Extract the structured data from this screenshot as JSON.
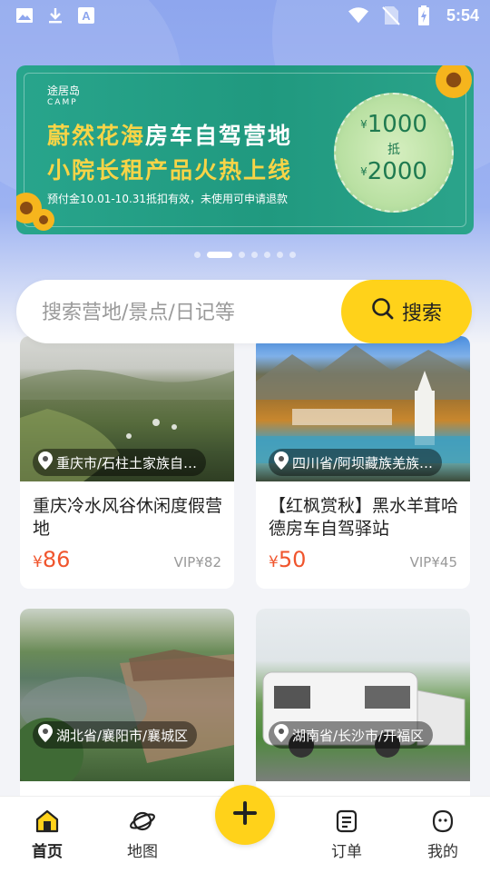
{
  "status_bar": {
    "time": "5:54",
    "left_icons": [
      "image-icon",
      "download-icon",
      "text-a-icon"
    ],
    "right_icons": [
      "wifi-icon",
      "no-sim-icon",
      "battery-charging-icon"
    ]
  },
  "banner": {
    "brand": "途居岛",
    "brand_en": "CAMP",
    "title_line1_highlight": "蔚然花海",
    "title_line1_rest": "房车自驾营地",
    "title_line2": "小院长租产品火热上线",
    "subtitle": "预付金10.01-10.31抵扣有效，未使用可申请退款",
    "coupon_amount1": "1000",
    "coupon_mid": "抵",
    "coupon_amount2": "2000",
    "currency": "¥"
  },
  "carousel": {
    "count": 7,
    "active_index": 1
  },
  "search": {
    "placeholder": "搜索营地/景点/日记等",
    "button_label": "搜索"
  },
  "cards": [
    {
      "location": "重庆市/石柱土家族自…",
      "title": "重庆冷水风谷休闲度假营地",
      "price_currency": "¥",
      "price": "86",
      "vip": "VIP¥82"
    },
    {
      "location": "四川省/阿坝藏族羌族…",
      "title": "【红枫赏秋】黑水羊茸哈德房车自驾驿站",
      "price_currency": "¥",
      "price": "50",
      "vip": "VIP¥45"
    },
    {
      "location": "湖北省/襄阳市/襄城区",
      "title": "",
      "price_currency": "",
      "price": "",
      "vip": ""
    },
    {
      "location": "湖南省/长沙市/开福区",
      "title": "",
      "price_currency": "",
      "price": "",
      "vip": ""
    }
  ],
  "nav": {
    "items": [
      {
        "label": "首页",
        "icon": "home-icon"
      },
      {
        "label": "地图",
        "icon": "planet-map-icon"
      },
      {
        "label": "订单",
        "icon": "order-list-icon"
      },
      {
        "label": "我的",
        "icon": "profile-icon"
      }
    ],
    "fab_icon": "plus-icon"
  },
  "colors": {
    "accent_yellow": "#ffd21a",
    "price_red": "#f0552d",
    "header_blue": "#8ea6ee",
    "banner_green": "#23a086"
  }
}
